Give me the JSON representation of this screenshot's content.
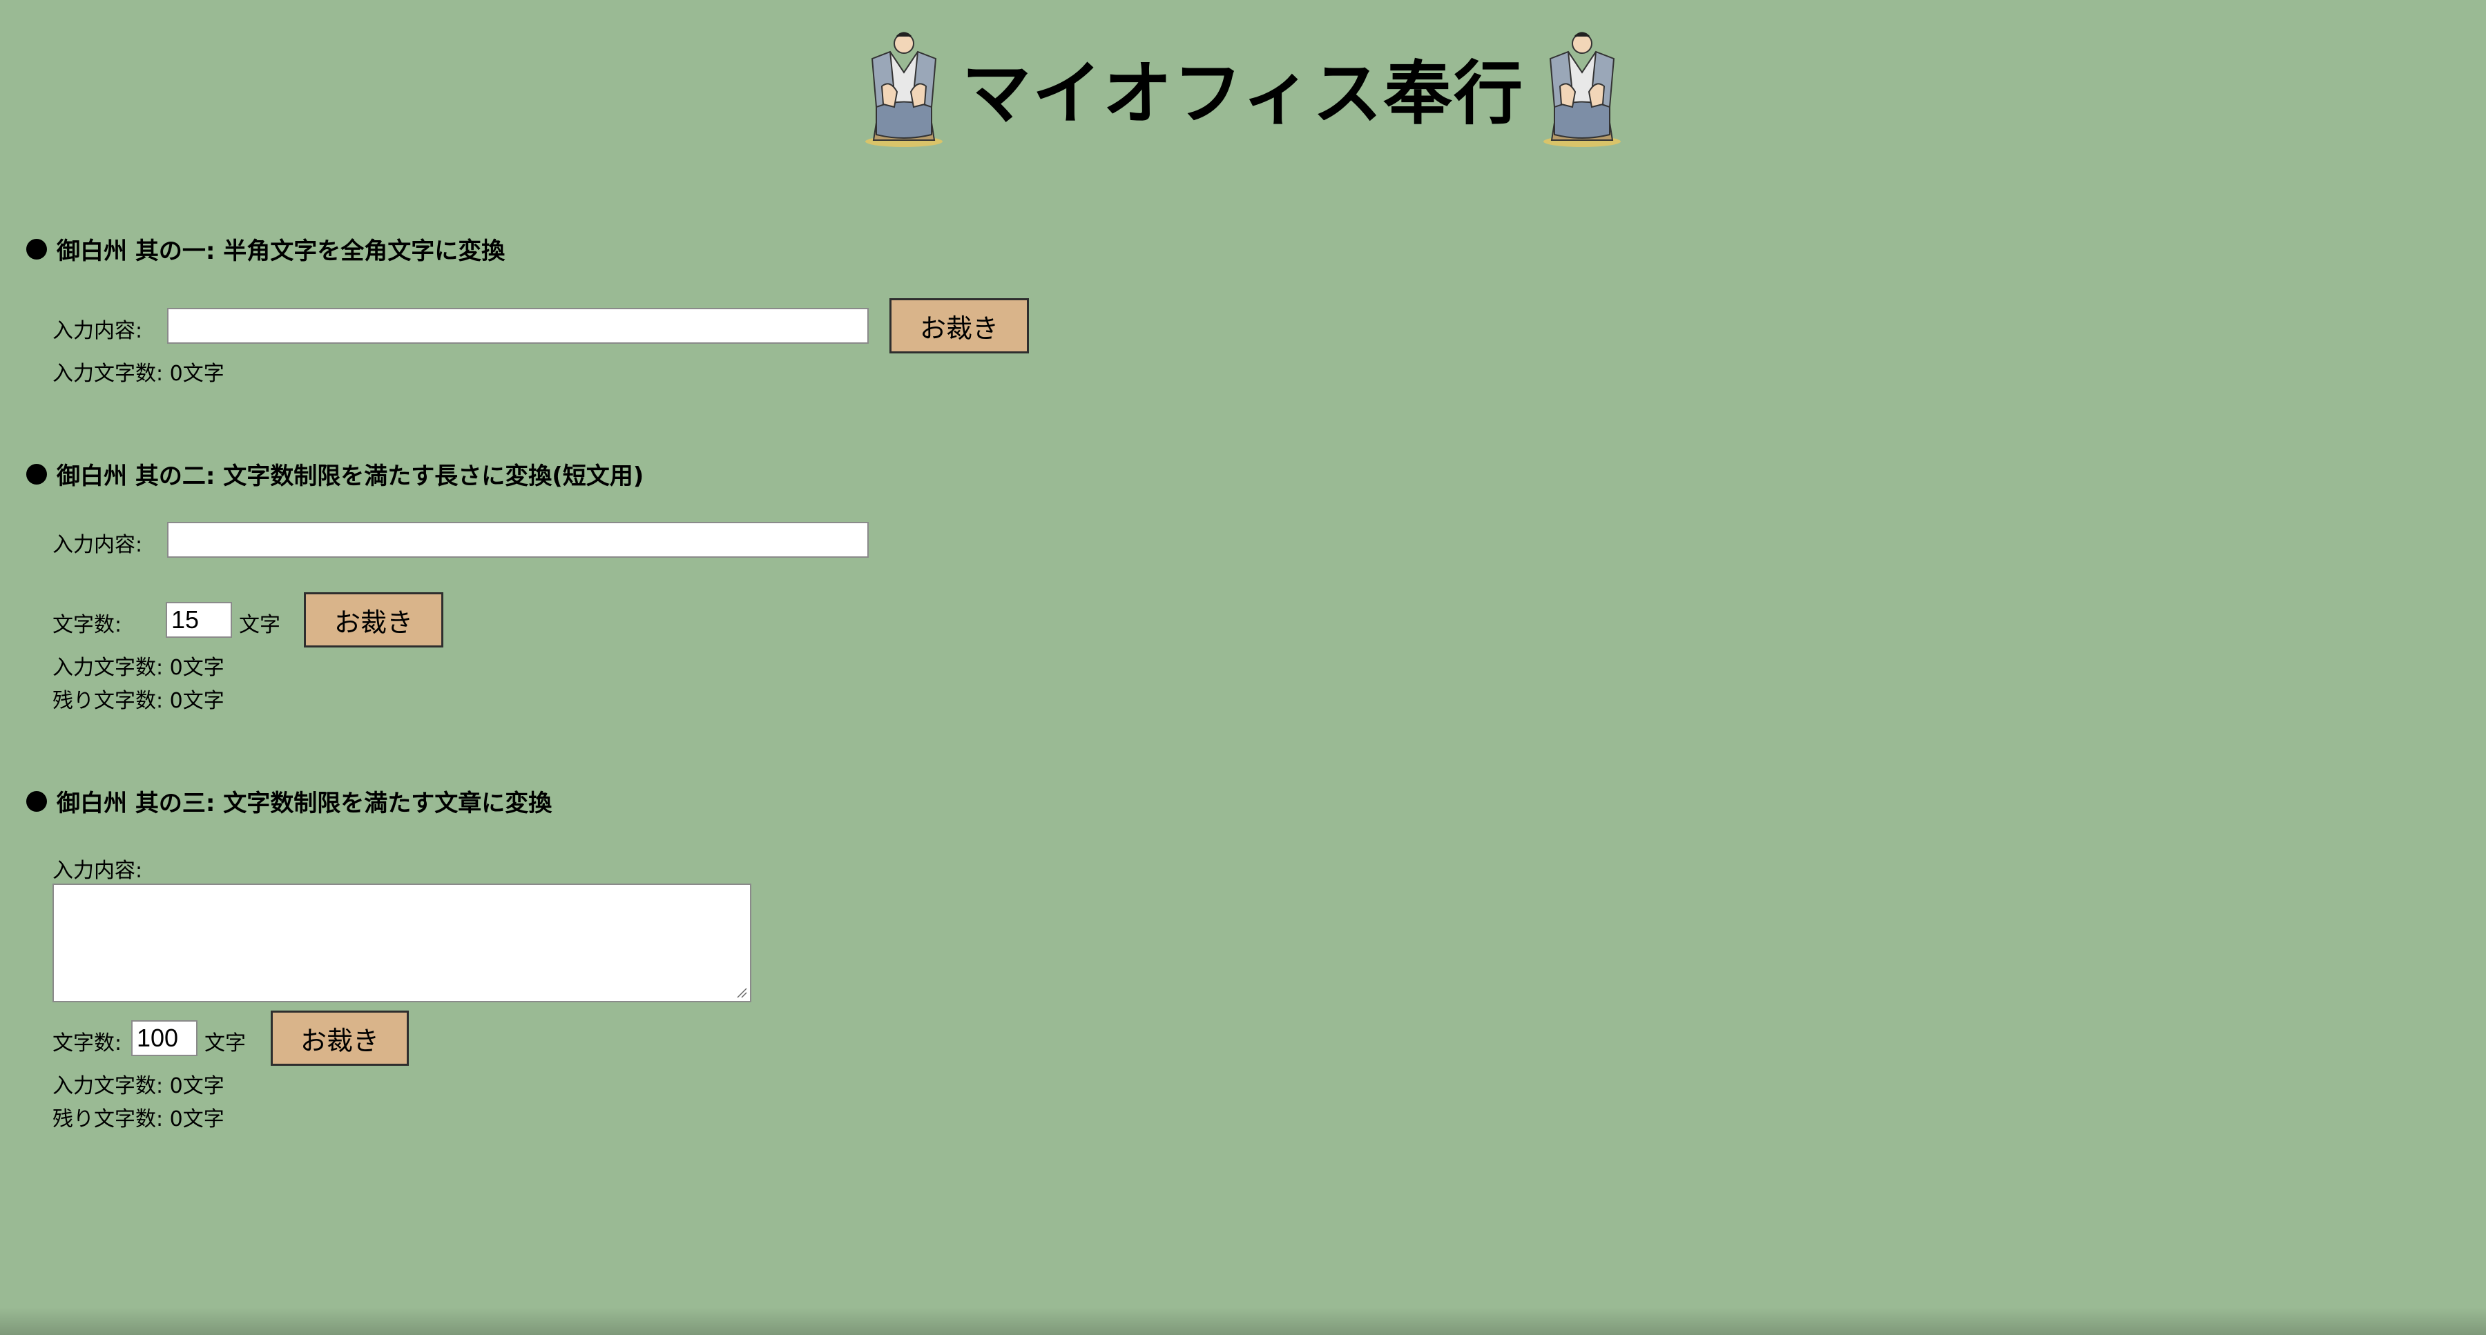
{
  "header": {
    "title": "マイオフィス奉行",
    "left_figure_icon": "samurai-figure-icon",
    "right_figure_icon": "samurai-figure-icon"
  },
  "section1": {
    "heading": "御白州 其の一: 半角文字を全角文字に変換",
    "input_label": "入力内容:",
    "input_value": "",
    "button_label": "お裁き",
    "count_text": "入力文字数: 0文字"
  },
  "section2": {
    "heading": "御白州 其の二: 文字数制限を満たす長さに変換(短文用)",
    "input_label": "入力内容:",
    "input_value": "",
    "limit_label": "文字数:",
    "limit_value": "15",
    "limit_unit": "文字",
    "button_label": "お裁き",
    "count_text": "入力文字数: 0文字",
    "remaining_text": "残り文字数: 0文字"
  },
  "section3": {
    "heading": "御白州 其の三: 文字数制限を満たす文章に変換",
    "input_label": "入力内容:",
    "input_value": "",
    "limit_label": "文字数:",
    "limit_value": "100",
    "limit_unit": "文字",
    "button_label": "お裁き",
    "count_text": "入力文字数: 0文字",
    "remaining_text": "残り文字数: 0文字"
  },
  "colors": {
    "background": "#9aba94",
    "button": "#d9b48a"
  }
}
